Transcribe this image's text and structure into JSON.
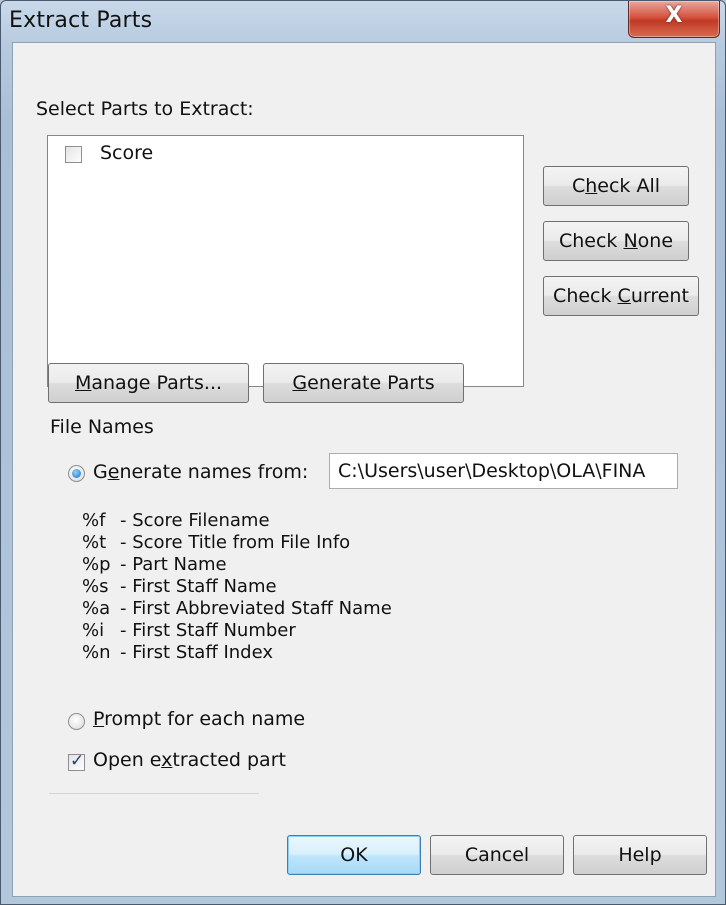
{
  "window": {
    "title": "Extract Parts",
    "close_glyph": "X"
  },
  "parts": {
    "label": "Select Parts to Extract:",
    "items": [
      {
        "label": "Score",
        "checked": false
      }
    ]
  },
  "side_buttons": {
    "check_all": {
      "pre": "C",
      "ul": "h",
      "post": "eck All"
    },
    "check_none": {
      "pre": "Check ",
      "ul": "N",
      "post": "one"
    },
    "check_current": {
      "pre": "Check ",
      "ul": "C",
      "post": "urrent"
    }
  },
  "manage_parts": {
    "pre": "",
    "ul": "M",
    "post": "anage Parts..."
  },
  "generate_parts": {
    "pre": "",
    "ul": "G",
    "post": "enerate Parts"
  },
  "file_names": {
    "label": "File Names",
    "generate_option": {
      "pre": "G",
      "ul": "e",
      "post": "nerate names from:",
      "selected": true
    },
    "pattern_value": "C:\\Users\\user\\Desktop\\OLA\\FINA",
    "codes": [
      {
        "key": "%f",
        "desc": "- Score Filename"
      },
      {
        "key": "%t",
        "desc": "- Score Title from File Info"
      },
      {
        "key": "%p",
        "desc": "- Part Name"
      },
      {
        "key": "%s",
        "desc": "- First Staff Name"
      },
      {
        "key": "%a",
        "desc": "- First Abbreviated Staff Name"
      },
      {
        "key": "%i",
        "desc": "- First Staff Number"
      },
      {
        "key": "%n",
        "desc": "- First Staff Index"
      }
    ],
    "prompt_option": {
      "pre": "",
      "ul": "P",
      "post": "rompt for each name",
      "selected": false
    },
    "open_extracted": {
      "pre": "Open e",
      "ul": "x",
      "post": "tracted part",
      "checked": true
    }
  },
  "dialog_buttons": {
    "ok": "OK",
    "cancel": "Cancel",
    "help": "Help"
  },
  "colors": {
    "close_red": "#c03a25",
    "default_button_border": "#3c7fb1"
  }
}
